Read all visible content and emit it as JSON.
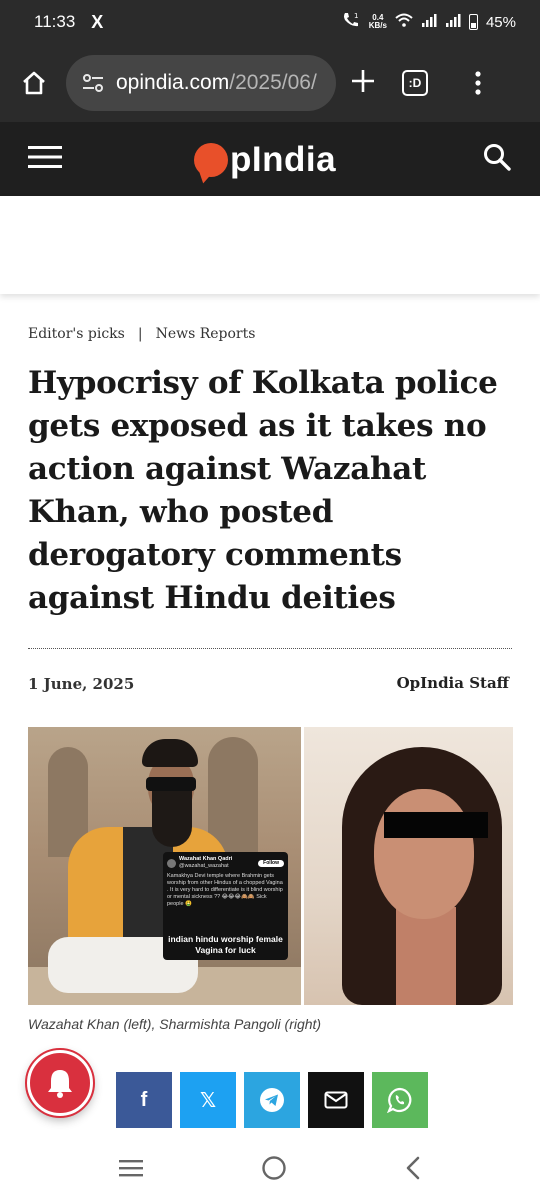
{
  "status_bar": {
    "time": "11:33",
    "app_icon": "X",
    "net_speed_value": "0.4",
    "net_speed_unit": "KB/s",
    "battery": "45%"
  },
  "browser": {
    "url_domain": "opindia.com",
    "url_path": "/2025/06/",
    "tabs_label": ":D"
  },
  "site": {
    "logo_text": "pIndia",
    "brand_color": "#e8502a"
  },
  "article": {
    "breadcrumbs": [
      "Editor's picks",
      "News Reports"
    ],
    "breadcrumb_separator": "|",
    "headline": "Hypocrisy of Kolkata police gets exposed as it takes no action against Wazahat Khan, who posted derogatory comments against Hindu deities",
    "date": "1 June, 2025",
    "author": "OpIndia Staff",
    "image_caption": "Wazahat Khan (left), Sharmishta Pangoli (right)",
    "embedded_tweet": {
      "name": "Wazahat Khan Qadri",
      "handle": "@wazahat_wazahat",
      "follow_label": "Follow",
      "text": "Kamakhya Devi temple where Brahmin gets worship from other Hindus of a chopped Vagina . It is very hard to differentiate is it blind worship or mental sickness ?? 😂😂😂🙈🙈 Sick people 🤮",
      "caption": "indian hindu worship female Vagina for luck"
    }
  },
  "share": {
    "facebook": "f",
    "x": "𝕏",
    "telegram": "telegram-icon",
    "email": "mail-icon",
    "whatsapp": "whatsapp-icon",
    "colors": {
      "facebook": "#3b5998",
      "x": "#1da1f2",
      "telegram": "#2ca5e0",
      "email": "#111111",
      "whatsapp": "#5cb85c",
      "notification": "#d9303e"
    }
  }
}
